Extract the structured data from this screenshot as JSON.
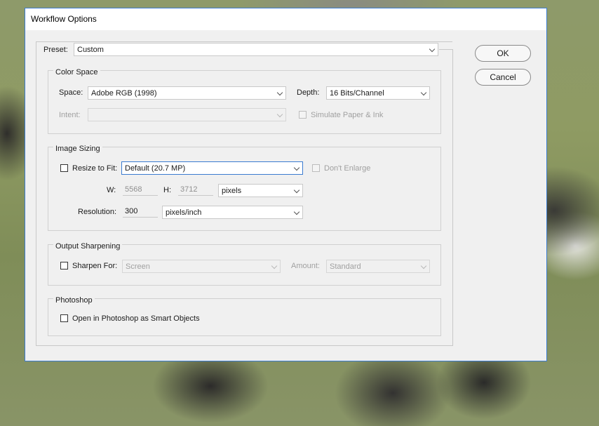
{
  "window": {
    "title": "Workflow Options"
  },
  "preset": {
    "label": "Preset:",
    "value": "Custom"
  },
  "buttons": {
    "ok": "OK",
    "cancel": "Cancel"
  },
  "color_space": {
    "title": "Color Space",
    "space_label": "Space:",
    "space_value": "Adobe RGB (1998)",
    "depth_label": "Depth:",
    "depth_value": "16 Bits/Channel",
    "intent_label": "Intent:",
    "intent_value": "",
    "simulate_label": "Simulate Paper & Ink"
  },
  "image_sizing": {
    "title": "Image Sizing",
    "resize_label": "Resize to Fit:",
    "resize_value": "Default  (20.7 MP)",
    "dont_enlarge_label": "Don't Enlarge",
    "w_label": "W:",
    "w_value": "5568",
    "h_label": "H:",
    "h_value": "3712",
    "dim_unit": "pixels",
    "resolution_label": "Resolution:",
    "resolution_value": "300",
    "resolution_unit": "pixels/inch"
  },
  "output_sharpening": {
    "title": "Output Sharpening",
    "sharpen_label": "Sharpen For:",
    "sharpen_value": "Screen",
    "amount_label": "Amount:",
    "amount_value": "Standard"
  },
  "photoshop": {
    "title": "Photoshop",
    "smart_objects_label": "Open in Photoshop as Smart Objects"
  }
}
